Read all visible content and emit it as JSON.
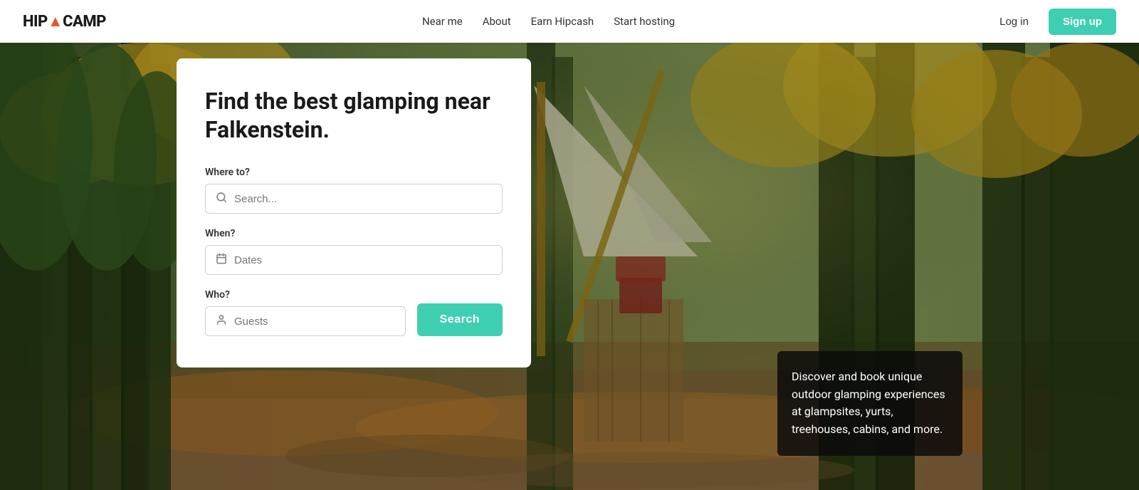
{
  "brand": {
    "name_part1": "HIP",
    "name_part2": "CAMP",
    "logo_icon": "▲"
  },
  "navbar": {
    "near_me": "Near me",
    "about": "About",
    "earn_hipcash": "Earn Hipcash",
    "start_hosting": "Start hosting",
    "login": "Log in",
    "signup": "Sign up"
  },
  "hero": {
    "heading": "Find the best glamping near Falkenstein."
  },
  "search_form": {
    "where_label": "Where to?",
    "where_placeholder": "Search...",
    "when_label": "When?",
    "when_placeholder": "Dates",
    "who_label": "Who?",
    "who_placeholder": "Guests",
    "search_button": "Search"
  },
  "info_box": {
    "text": "Discover and book unique outdoor glamping experiences at glampsites, yurts, treehouses, cabins, and more."
  }
}
